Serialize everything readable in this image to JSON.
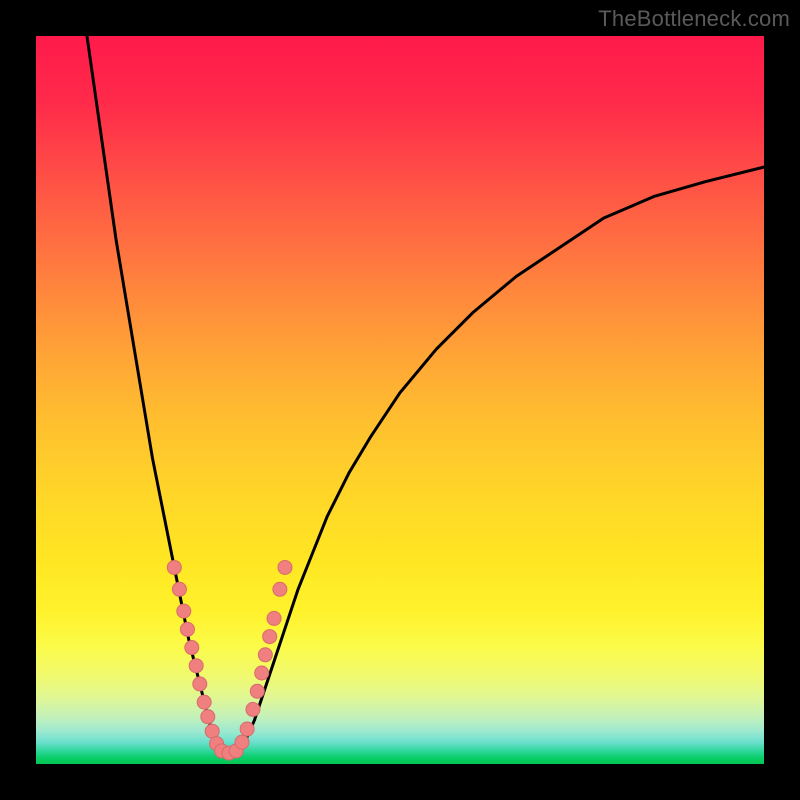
{
  "watermark": "TheBottleneck.com",
  "colors": {
    "frame": "#000000",
    "curve": "#000000",
    "marker_fill": "#f08080",
    "marker_stroke": "#d86a6a"
  },
  "chart_data": {
    "type": "line",
    "title": "",
    "xlabel": "",
    "ylabel": "",
    "xlim": [
      0,
      100
    ],
    "ylim": [
      0,
      100
    ],
    "grid": false,
    "legend": false,
    "note": "Two curves descending to a common minimum near x≈25; left branch starts near 100 at x≈7, right branch rises to ≈82 at x=100. Markers cluster near the trough (bottleneck zone).",
    "series": [
      {
        "name": "left_branch",
        "x": [
          7,
          8,
          9,
          10,
          11,
          12,
          13,
          14,
          15,
          16,
          17,
          18,
          19,
          20,
          21,
          22,
          23,
          24,
          25
        ],
        "y": [
          100,
          93,
          86,
          79,
          72,
          66,
          60,
          54,
          48,
          42,
          37,
          32,
          27,
          22,
          17,
          13,
          9,
          5,
          2
        ]
      },
      {
        "name": "trough",
        "x": [
          25,
          26,
          27,
          28
        ],
        "y": [
          1.5,
          1.2,
          1.2,
          1.5
        ]
      },
      {
        "name": "right_branch",
        "x": [
          28,
          30,
          32,
          34,
          36,
          38,
          40,
          43,
          46,
          50,
          55,
          60,
          66,
          72,
          78,
          85,
          92,
          100
        ],
        "y": [
          1.5,
          6,
          12,
          18,
          24,
          29,
          34,
          40,
          45,
          51,
          57,
          62,
          67,
          71,
          75,
          78,
          80,
          82
        ]
      }
    ],
    "markers": {
      "name": "bottleneck_points",
      "points": [
        {
          "x": 19.0,
          "y": 27
        },
        {
          "x": 19.7,
          "y": 24
        },
        {
          "x": 20.3,
          "y": 21
        },
        {
          "x": 20.8,
          "y": 18.5
        },
        {
          "x": 21.4,
          "y": 16
        },
        {
          "x": 22.0,
          "y": 13.5
        },
        {
          "x": 22.5,
          "y": 11
        },
        {
          "x": 23.1,
          "y": 8.5
        },
        {
          "x": 23.6,
          "y": 6.5
        },
        {
          "x": 24.2,
          "y": 4.5
        },
        {
          "x": 24.8,
          "y": 2.8
        },
        {
          "x": 25.5,
          "y": 1.8
        },
        {
          "x": 26.5,
          "y": 1.5
        },
        {
          "x": 27.5,
          "y": 1.8
        },
        {
          "x": 28.3,
          "y": 3.0
        },
        {
          "x": 29.0,
          "y": 4.8
        },
        {
          "x": 29.8,
          "y": 7.5
        },
        {
          "x": 30.4,
          "y": 10
        },
        {
          "x": 31.0,
          "y": 12.5
        },
        {
          "x": 31.5,
          "y": 15
        },
        {
          "x": 32.1,
          "y": 17.5
        },
        {
          "x": 32.7,
          "y": 20
        },
        {
          "x": 33.5,
          "y": 24
        },
        {
          "x": 34.2,
          "y": 27
        }
      ]
    }
  }
}
